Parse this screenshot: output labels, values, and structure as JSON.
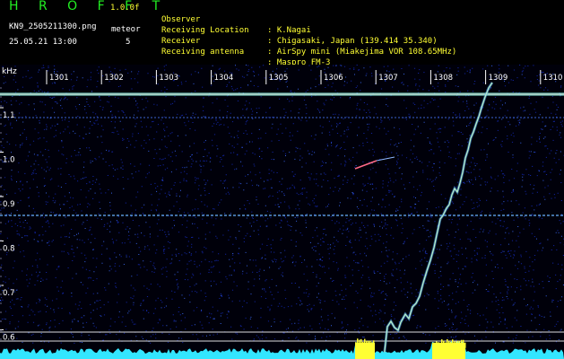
{
  "app": {
    "title": "H R O F F T",
    "version": "1.0.0f",
    "filename": "KN9_2505211300.png",
    "datetime": "25.05.21 13:00",
    "meteor_label": "meteor",
    "meteor_count": "5"
  },
  "info": [
    {
      "key": "Observer",
      "value": ": K.Nagai"
    },
    {
      "key": "Receiving Location",
      "value": ": Chigasaki, Japan (139.414 35.340)"
    },
    {
      "key": "Receiver",
      "value": ": AirSpy mini (Miakejima VOR 108.65MHz)"
    },
    {
      "key": "Receiving antenna",
      "value": ": Maspro FM-3"
    }
  ],
  "axes": {
    "y_unit": "kHz",
    "x_ticks": [
      "1301",
      "1302",
      "1303",
      "1304",
      "1305",
      "1306",
      "1307",
      "1308",
      "1309",
      "1310"
    ],
    "y_ticks": [
      "1.1",
      "1.0",
      "0.9",
      "0.8",
      "0.7",
      "0.6"
    ]
  },
  "colors": {
    "header_green": "#22ee22",
    "header_yellow": "#ffff33",
    "background": "#000000",
    "noise": "#1428b4",
    "carrier": "#7fe0d0",
    "meteor_trace": "#b8f0c8",
    "baseline": "#33e6ff",
    "burst": "#ffff33"
  }
}
